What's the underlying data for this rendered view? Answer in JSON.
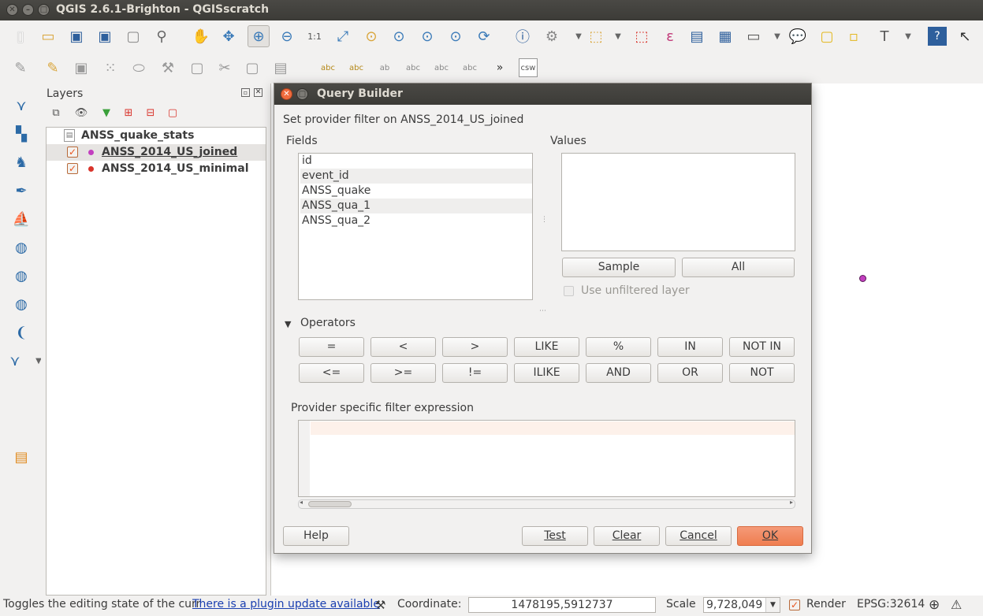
{
  "window": {
    "title": "QGIS 2.6.1-Brighton - QGISscratch"
  },
  "layers": {
    "title": "Layers",
    "items": [
      {
        "label": "ANSS_quake_stats"
      },
      {
        "label": "ANSS_2014_US_joined"
      },
      {
        "label": "ANSS_2014_US_minimal"
      }
    ]
  },
  "toolbar2": {
    "overflow": "»",
    "csw": "csw"
  },
  "dialog": {
    "title": "Query Builder",
    "subtitle": "Set provider filter on ANSS_2014_US_joined",
    "fields_label": "Fields",
    "fields": [
      "id",
      "event_id",
      "ANSS_quake",
      "ANSS_qua_1",
      "ANSS_qua_2"
    ],
    "values_label": "Values",
    "sample_button": "Sample",
    "all_button": "All",
    "use_unfiltered": "Use unfiltered layer",
    "operators_label": "Operators",
    "operators_row1": [
      "=",
      "<",
      ">",
      "LIKE",
      "%",
      "IN",
      "NOT IN"
    ],
    "operators_row2": [
      "<=",
      ">=",
      "!=",
      "ILIKE",
      "AND",
      "OR",
      "NOT"
    ],
    "expression_label": "Provider specific filter expression",
    "expression_value": "",
    "help_button": "Help",
    "test_button": "Test",
    "clear_button": "Clear",
    "cancel_button": "Cancel",
    "ok_button": "OK"
  },
  "status": {
    "message": "Toggles the editing state of the curr",
    "plugin_link": "There is a plugin update available",
    "coordinate_label": "Coordinate:",
    "coordinate_value": "1478195,5912737",
    "scale_label": "Scale",
    "scale_value": "9,728,049",
    "render_label": "Render",
    "crs": "EPSG:32614"
  },
  "colors": {
    "accent": "#ef7d4f",
    "point": "#c23fbf",
    "link": "#1a3fb0"
  }
}
